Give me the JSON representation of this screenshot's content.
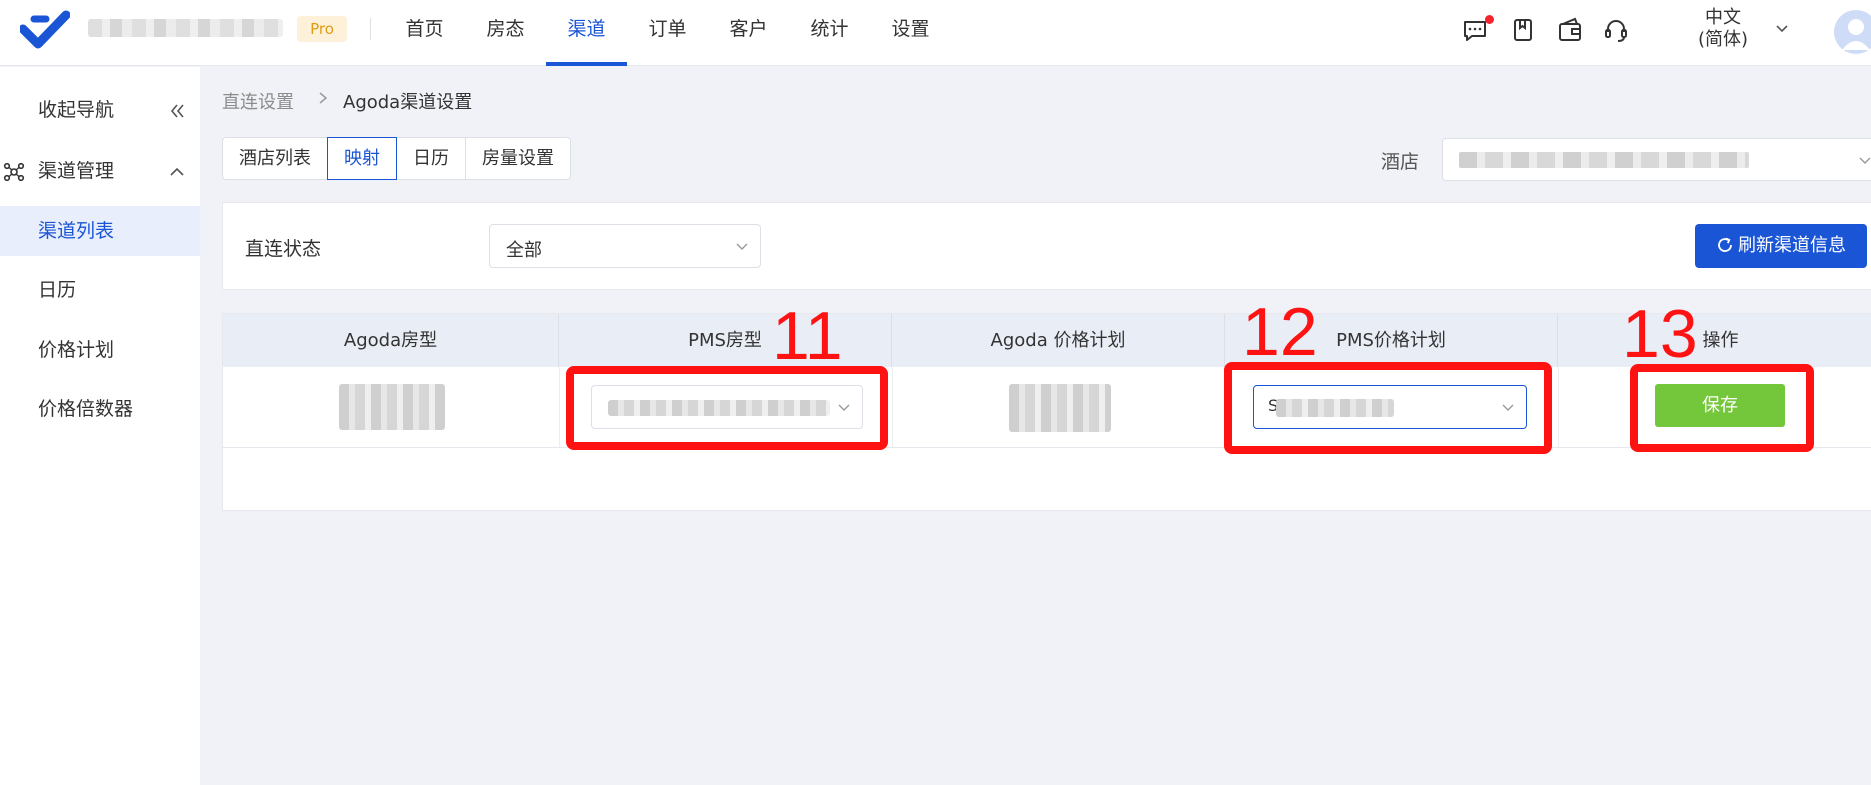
{
  "header": {
    "badge": "Pro",
    "nav": [
      "首页",
      "房态",
      "渠道",
      "订单",
      "客户",
      "统计",
      "设置"
    ],
    "active_nav": "渠道",
    "language": [
      "中文",
      "(简体)"
    ]
  },
  "sidebar": {
    "items": [
      {
        "label": "收起导航",
        "icon": "collapse-icon"
      },
      {
        "label": "渠道管理",
        "icon": "channels-icon"
      },
      {
        "label": "渠道列表",
        "active": true
      },
      {
        "label": "日历"
      },
      {
        "label": "价格计划"
      },
      {
        "label": "价格倍数器"
      }
    ]
  },
  "breadcrumb": {
    "parent": "直连设置",
    "current": "Agoda渠道设置"
  },
  "tabs": [
    "酒店列表",
    "映射",
    "日历",
    "房量设置"
  ],
  "active_tab": "映射",
  "hotel": {
    "label": "酒店",
    "value_initial": "r"
  },
  "filter": {
    "label": "直连状态",
    "value": "全部",
    "refresh_label": "刷新渠道信息"
  },
  "table": {
    "headers": [
      "Agoda房型",
      "PMS房型",
      "Agoda 价格计划",
      "PMS价格计划",
      "操作"
    ],
    "rows": [
      {
        "pms_rate_initial": "S",
        "action_label": "保存"
      }
    ]
  },
  "annotations": [
    "11",
    "12",
    "13"
  ],
  "colors": {
    "primary": "#1a55d6",
    "save_button": "#74c63a",
    "annotation": "#ff1212"
  }
}
